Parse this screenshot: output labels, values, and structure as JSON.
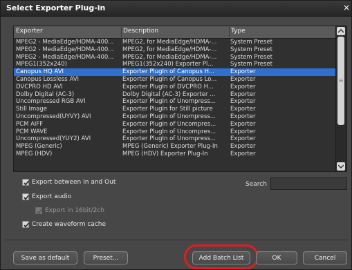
{
  "window": {
    "title": "Select Exporter Plug-in",
    "close_glyph": "×"
  },
  "list": {
    "columns": [
      "Exporter",
      "Description",
      "Type"
    ],
    "rows": [
      {
        "exporter": "MPEG2 - MediaEdge/HDMA-400...",
        "description": "MPEG2, for MediaEdge/HDMA-...",
        "type": "System Preset"
      },
      {
        "exporter": "MPEG2 - MediaEdge/HDMA-400...",
        "description": "MPEG2, for MediaEdge/HDMA-...",
        "type": "System Preset"
      },
      {
        "exporter": "MPEG2 - MediaEdge/HDMA-400...",
        "description": "MPEG2, for MediaEdge/HDMA-...",
        "type": "System Preset"
      },
      {
        "exporter": "MPEG1(352x240)",
        "description": "MPEG1(352x240)  Exporter Pl...",
        "type": "System Preset"
      },
      {
        "exporter": "Canopus HQ AVI",
        "description": "Exporter PlugIn of Canopus H...",
        "type": "Exporter",
        "selected": true
      },
      {
        "exporter": "Canopus Lossless AVI",
        "description": "Exporter PlugIn of Canopus Lo...",
        "type": "Exporter"
      },
      {
        "exporter": "DVCPRO HD AVI",
        "description": "Exporter PlugIn of DVCPRO H...",
        "type": "Exporter"
      },
      {
        "exporter": "Dolby Digital (AC-3)",
        "description": "Dolby Digital (AC-3) Exporter ...",
        "type": "Exporter"
      },
      {
        "exporter": "Uncompressed RGB AVI",
        "description": "Exporter PlugIn of Unompress...",
        "type": "Exporter"
      },
      {
        "exporter": "Still Image",
        "description": "Exporter PlugIn for Still picture",
        "type": "Exporter"
      },
      {
        "exporter": "Uncompressed(UYVY) AVI",
        "description": "Exporter PlugIn of Unompress...",
        "type": "Exporter"
      },
      {
        "exporter": "PCM AIFF",
        "description": "Exporter PlugIn of Uncompres...",
        "type": "Exporter"
      },
      {
        "exporter": "PCM WAVE",
        "description": "Exporter PlugIn of Uncompres...",
        "type": "Exporter"
      },
      {
        "exporter": "Uncompressed(YUY2) AVI",
        "description": "Exporter PlugIn of Unompress...",
        "type": "Exporter"
      },
      {
        "exporter": "MPEG (Generic)",
        "description": "MPEG (Generic) Exporter Plug-In",
        "type": "Exporter"
      },
      {
        "exporter": "MPEG (HDV)",
        "description": "MPEG (HDV) Exporter Plug-In",
        "type": "Exporter"
      }
    ],
    "selection_color": "#2f6fcf"
  },
  "options": {
    "export_between": {
      "label": "Export between In and Out",
      "checked": true
    },
    "export_audio": {
      "label": "Export audio",
      "checked": true
    },
    "export_16bit": {
      "label": "Export in 16bit/2ch",
      "checked": true,
      "disabled": true
    },
    "waveform_cache": {
      "label": "Create waveform cache",
      "checked": true
    }
  },
  "search": {
    "label": "Search",
    "value": ""
  },
  "buttons": {
    "save_default": "Save as default",
    "preset": "Preset...",
    "add_batch": "Add Batch List",
    "ok": "OK",
    "cancel": "Cancel"
  },
  "highlight_color": "#e41b23"
}
